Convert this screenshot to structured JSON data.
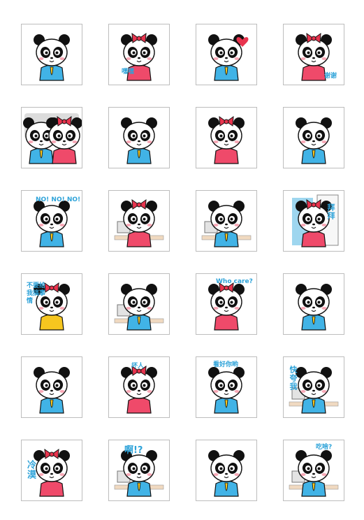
{
  "stickers": [
    {
      "caption": ""
    },
    {
      "caption": "嘿嘿"
    },
    {
      "caption": ""
    },
    {
      "caption": "谢谢"
    },
    {
      "caption": ""
    },
    {
      "caption": ""
    },
    {
      "caption": ""
    },
    {
      "caption": ""
    },
    {
      "caption": "NO! NO! NO!"
    },
    {
      "caption": ""
    },
    {
      "caption": ""
    },
    {
      "caption": "拜拜"
    },
    {
      "caption": "不要给我搞事情"
    },
    {
      "caption": ""
    },
    {
      "caption": "Who care?"
    },
    {
      "caption": ""
    },
    {
      "caption": ""
    },
    {
      "caption": "坏人"
    },
    {
      "caption": "看好你哟"
    },
    {
      "caption": "快夸我"
    },
    {
      "caption": "冷漠"
    },
    {
      "caption": "啊!?"
    },
    {
      "caption": ""
    },
    {
      "caption": "吃啥?"
    }
  ],
  "colors": {
    "tile_border": "#bdbdbd",
    "caption_blue": "#2ea3d9",
    "bow_pink": "#e8344e",
    "shirt_blue": "#41b3e6",
    "shirt_pink": "#ef4a6a",
    "tie_yellow": "#f6c61f",
    "fur_black": "#111111"
  }
}
